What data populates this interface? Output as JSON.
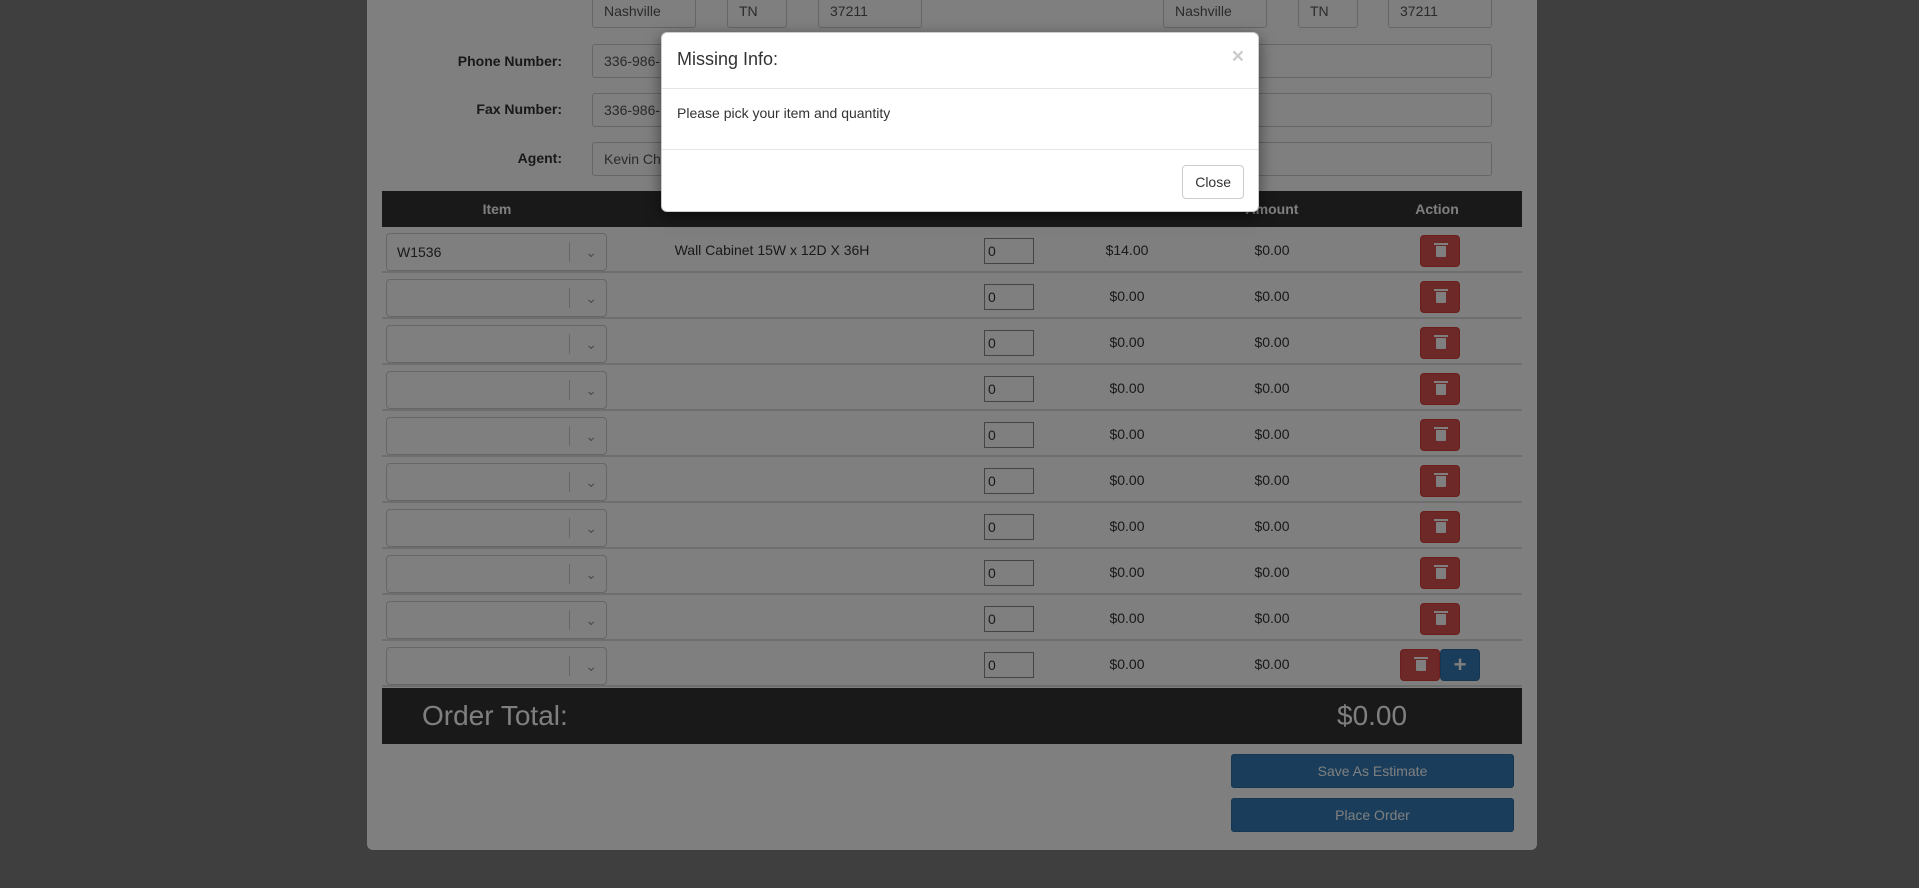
{
  "address": {
    "bill_city": "Nashville",
    "bill_state": "TN",
    "bill_zip": "37211",
    "ship_city": "Nashville",
    "ship_state": "TN",
    "ship_zip": "37211"
  },
  "form": {
    "phone_label": "Phone Number:",
    "phone_value": "336-986-",
    "fax_label": "Fax Number:",
    "fax_value": "336-986-",
    "agent_label": "Agent:",
    "agent_value": "Kevin Ch",
    "phone2_value": "0",
    "fax2_value": "0"
  },
  "table": {
    "headers": {
      "item": "Item",
      "amount": "Amount",
      "action": "Action"
    },
    "rows": [
      {
        "item": "W1536",
        "description": "Wall Cabinet 15W x 12D X 36H",
        "qty": "0",
        "price": "$14.00",
        "amount": "$0.00"
      },
      {
        "item": "",
        "description": "",
        "qty": "0",
        "price": "$0.00",
        "amount": "$0.00"
      },
      {
        "item": "",
        "description": "",
        "qty": "0",
        "price": "$0.00",
        "amount": "$0.00"
      },
      {
        "item": "",
        "description": "",
        "qty": "0",
        "price": "$0.00",
        "amount": "$0.00"
      },
      {
        "item": "",
        "description": "",
        "qty": "0",
        "price": "$0.00",
        "amount": "$0.00"
      },
      {
        "item": "",
        "description": "",
        "qty": "0",
        "price": "$0.00",
        "amount": "$0.00"
      },
      {
        "item": "",
        "description": "",
        "qty": "0",
        "price": "$0.00",
        "amount": "$0.00"
      },
      {
        "item": "",
        "description": "",
        "qty": "0",
        "price": "$0.00",
        "amount": "$0.00"
      },
      {
        "item": "",
        "description": "",
        "qty": "0",
        "price": "$0.00",
        "amount": "$0.00"
      },
      {
        "item": "",
        "description": "",
        "qty": "0",
        "price": "$0.00",
        "amount": "$0.00"
      }
    ],
    "add_glyph": "+"
  },
  "total": {
    "label": "Order Total:",
    "value": "$0.00"
  },
  "buttons": {
    "save_estimate": "Save As Estimate",
    "place_order": "Place Order"
  },
  "modal": {
    "title": "Missing Info:",
    "close_x": "×",
    "message": "Please pick your item and quantity",
    "close_button": "Close"
  },
  "colors": {
    "danger": "#d9534f",
    "primary": "#337ab7",
    "header_dark": "#333333"
  }
}
